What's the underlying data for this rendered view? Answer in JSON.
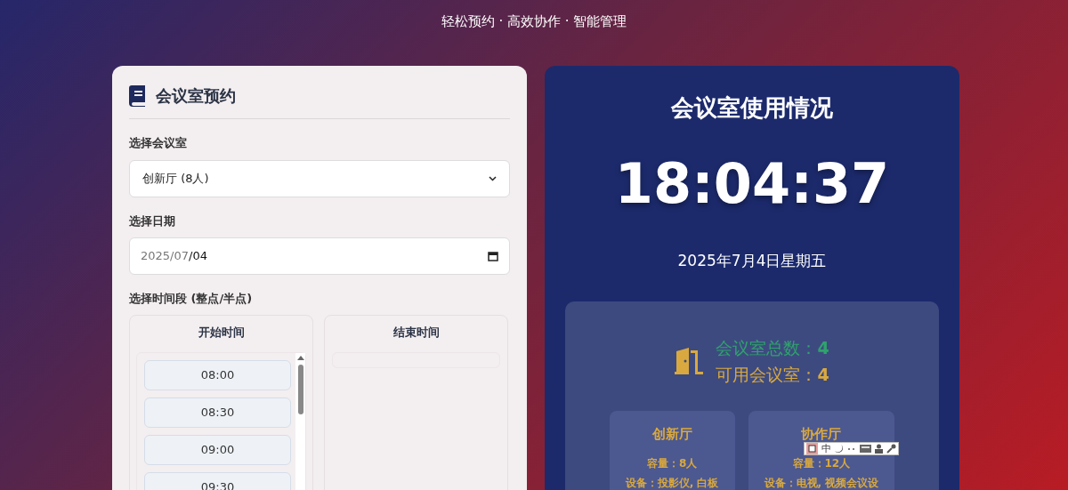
{
  "header": {
    "subtitle": "轻松预约 · 高效协作 · 智能管理"
  },
  "booking": {
    "title": "会议室预约",
    "room_label": "选择会议室",
    "room_value": "创新厅 (8人)",
    "date_label": "选择日期",
    "date_parts": [
      {
        "text": "2025/07",
        "selected": false
      },
      {
        "text": "/04",
        "selected": true
      }
    ],
    "time_label": "选择时间段 (整点/半点)",
    "start": {
      "title": "开始时间",
      "slots": [
        {
          "label": "08:00",
          "selected": false
        },
        {
          "label": "08:30",
          "selected": false
        },
        {
          "label": "09:00",
          "selected": false
        },
        {
          "label": "09:30",
          "selected": false
        }
      ]
    },
    "end": {
      "title": "结束时间"
    }
  },
  "status": {
    "title": "会议室使用情况",
    "clock": "18:04:37",
    "date": "2025年7月4日星期五",
    "total": {
      "label": "会议室总数：",
      "value": "4"
    },
    "available": {
      "label": "可用会议室：",
      "value": "4"
    },
    "rooms": [
      {
        "name": "创新厅",
        "capacity": "容量：8人",
        "equipment": "设备：投影仪, 白板"
      },
      {
        "name": "协作厅",
        "capacity": "容量：12人",
        "equipment": "设备：电视, 视频会议设"
      }
    ]
  },
  "ime_toolbar": {
    "mode": "中"
  }
}
